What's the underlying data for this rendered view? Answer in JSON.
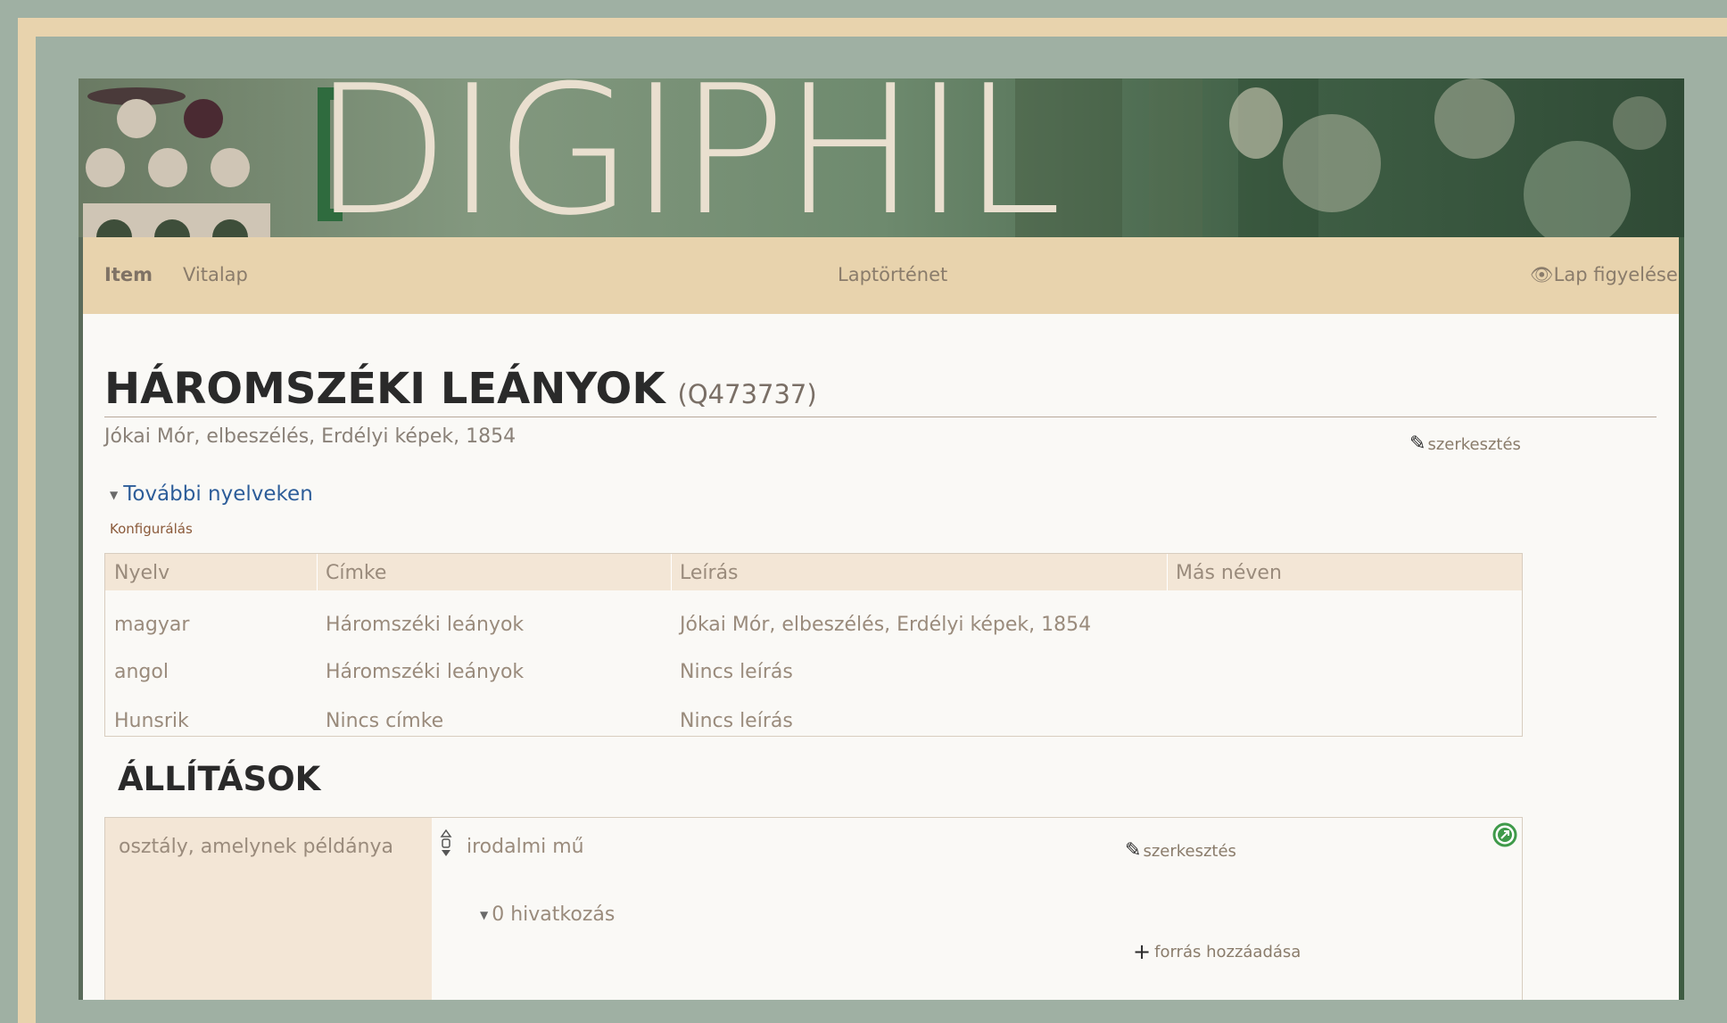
{
  "banner": {
    "logo_text": "DIGIPHIL"
  },
  "nav": {
    "tabs": [
      "Item",
      "Vitalap"
    ],
    "history": "Laptörténet",
    "watch": "Lap figyelése"
  },
  "item": {
    "title": "HÁROMSZÉKI LEÁNYOK",
    "qid": "(Q473737)",
    "description": "Jókai Mór, elbeszélés, Erdélyi képek, 1854",
    "edit_label": "szerkesztés"
  },
  "languages": {
    "toggle": "További nyelveken",
    "configure": "Konfigurálás",
    "headers": [
      "Nyelv",
      "Címke",
      "Leírás",
      "Más néven"
    ],
    "rows": [
      [
        "magyar",
        "Háromszéki leányok",
        "Jókai Mór, elbeszélés, Erdélyi képek, 1854",
        ""
      ],
      [
        "angol",
        "Háromszéki leányok",
        "Nincs leírás",
        ""
      ],
      [
        "Hunsrik",
        "Nincs címke",
        "Nincs leírás",
        ""
      ]
    ]
  },
  "statements": {
    "heading": "ÁLLÍTÁSOK",
    "items": [
      {
        "property": "osztály, amelynek példánya",
        "value": "irodalmi mű",
        "edit_label": "szerkesztés",
        "references": "0 hivatkozás",
        "add_source": "forrás hozzáadása"
      }
    ]
  },
  "colors": {
    "accent_beige": "#e8d3ad",
    "link_blue": "#2d5d99",
    "frame_green": "#9fb0a3"
  }
}
